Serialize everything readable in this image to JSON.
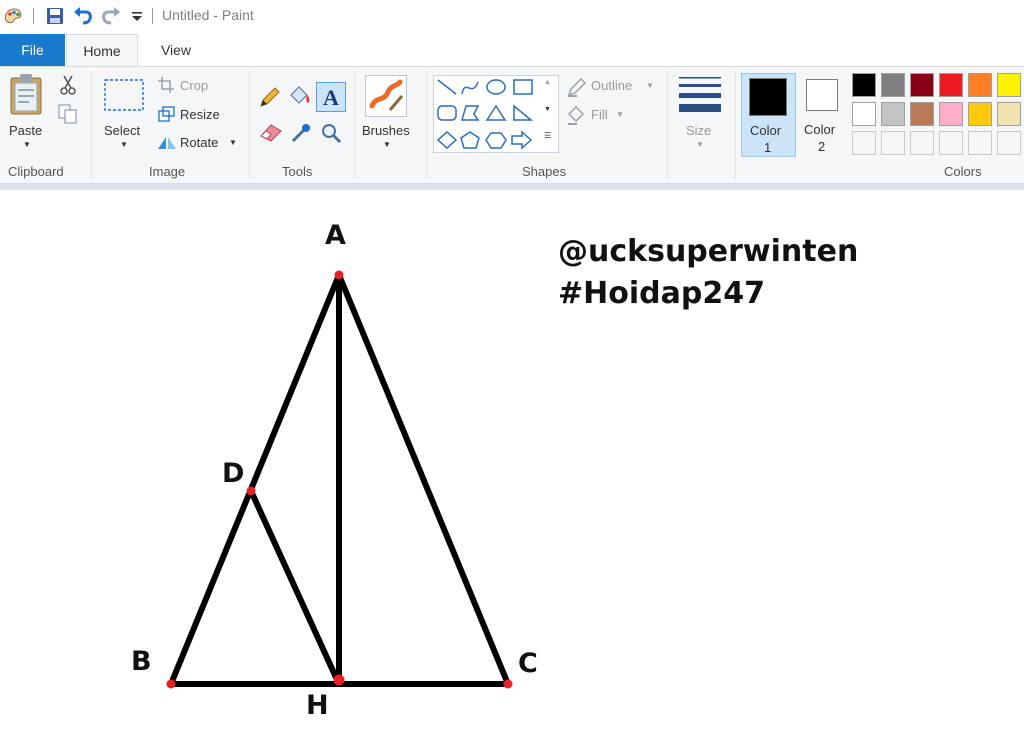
{
  "window": {
    "title": "Untitled - Paint"
  },
  "tabs": {
    "file": "File",
    "home": "Home",
    "view": "View"
  },
  "clipboard": {
    "paste": "Paste",
    "group": "Clipboard"
  },
  "image": {
    "select": "Select",
    "crop": "Crop",
    "resize": "Resize",
    "rotate": "Rotate",
    "group": "Image"
  },
  "tools": {
    "group": "Tools"
  },
  "brushes": {
    "label": "Brushes"
  },
  "shapes": {
    "outline": "Outline",
    "fill": "Fill",
    "group": "Shapes"
  },
  "size": {
    "label": "Size"
  },
  "colors": {
    "color1_label": "Color",
    "color1_num": "1",
    "color2_label": "Color",
    "color2_num": "2",
    "group": "Colors",
    "color1": "#000000",
    "color2": "#ffffff",
    "palette_row1": [
      "#000000",
      "#7f7f7f",
      "#880015",
      "#ed1c24",
      "#ff7f27",
      "#fff200"
    ],
    "palette_row2": [
      "#ffffff",
      "#c3c3c3",
      "#b97a57",
      "#ffaec9",
      "#ffc90e",
      "#efe4b0"
    ]
  },
  "canvas": {
    "labels": {
      "a": "A",
      "b": "B",
      "c": "C",
      "d": "D",
      "h": "H"
    },
    "watermark_line1": "@ucksuperwinten",
    "watermark_line2": "#Hoidap247",
    "stroke_color": "#000000",
    "point_color": "#e8202a"
  }
}
